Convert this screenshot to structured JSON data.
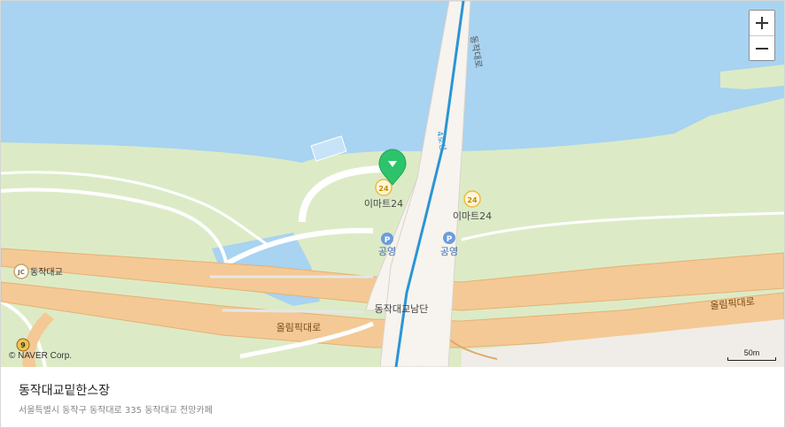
{
  "map": {
    "labels": {
      "road_top": "동작대로",
      "line_label": "4호선",
      "emart_left": "이마트24",
      "emart_right": "이마트24",
      "parking_left": "공영",
      "parking_right": "공영",
      "emart_badge": "24",
      "parking_glyph": "P",
      "junction_badge": "JC",
      "junction_name": "동작대교",
      "bridge_south": "동작대교남단",
      "olympic_left": "올림픽대로",
      "olympic_right": "올림픽대로",
      "route_number": "9"
    },
    "colors": {
      "water": "#a8d3f1",
      "park": "#dcebc6",
      "highway": "#f4c995",
      "road": "#ffffff",
      "bridge": "#f7f3ee",
      "subway_line": "#2a95d5",
      "marker": "#2dc36a"
    },
    "marker_icon": "map-pin-icon",
    "copyright": "© NAVER Corp.",
    "scale_label": "50m"
  },
  "controls": {
    "zoom_in_icon": "plus-icon",
    "zoom_out_icon": "minus-icon"
  },
  "place": {
    "name": "동작대교밑한스장",
    "address": "서울특별시 동작구 동작대로 335 동작대교 전망카페"
  }
}
